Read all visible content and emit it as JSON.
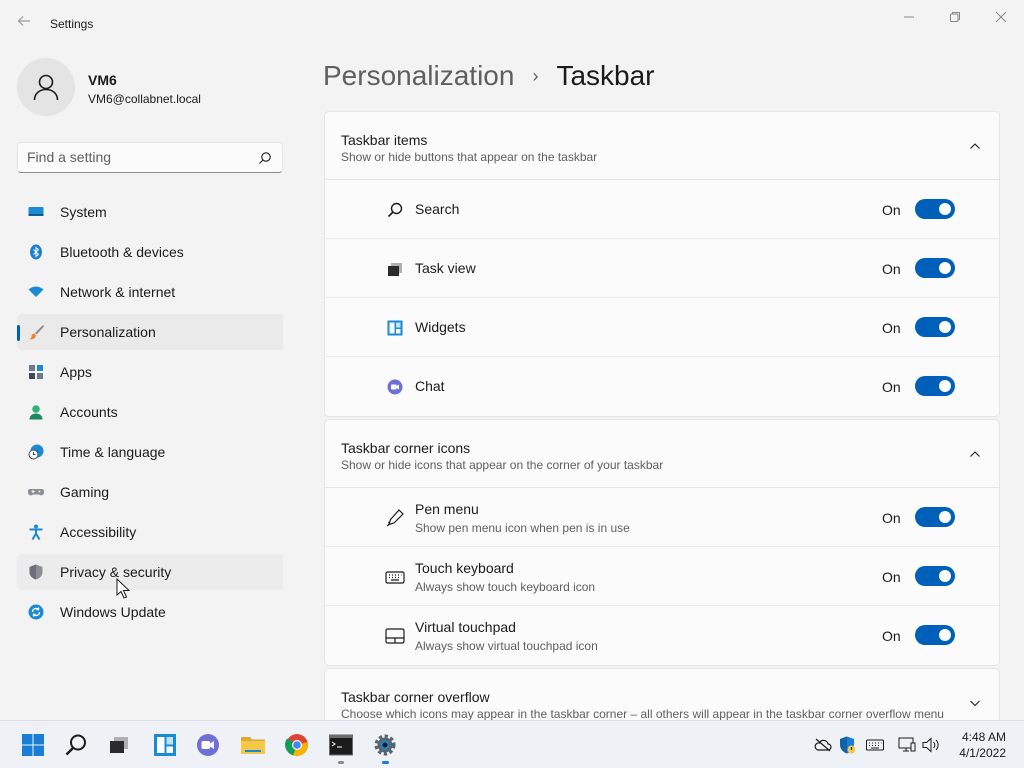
{
  "window": {
    "title": "Settings"
  },
  "profile": {
    "name": "VM6",
    "email": "VM6@collabnet.local"
  },
  "search": {
    "placeholder": "Find a setting"
  },
  "nav": {
    "items": [
      {
        "label": "System",
        "icon": "system-icon"
      },
      {
        "label": "Bluetooth & devices",
        "icon": "bluetooth-icon"
      },
      {
        "label": "Network & internet",
        "icon": "wifi-icon"
      },
      {
        "label": "Personalization",
        "icon": "brush-icon",
        "selected": true
      },
      {
        "label": "Apps",
        "icon": "apps-icon"
      },
      {
        "label": "Accounts",
        "icon": "accounts-icon"
      },
      {
        "label": "Time & language",
        "icon": "clock-globe-icon"
      },
      {
        "label": "Gaming",
        "icon": "gamepad-icon"
      },
      {
        "label": "Accessibility",
        "icon": "accessibility-icon"
      },
      {
        "label": "Privacy & security",
        "icon": "shield-icon",
        "hover": true
      },
      {
        "label": "Windows Update",
        "icon": "update-icon"
      }
    ]
  },
  "breadcrumb": {
    "parent": "Personalization",
    "separator": "›",
    "current": "Taskbar"
  },
  "sections": {
    "items": {
      "title": "Taskbar items",
      "description": "Show or hide buttons that appear on the taskbar",
      "rows": [
        {
          "label": "Search",
          "state": "On",
          "icon": "search-icon"
        },
        {
          "label": "Task view",
          "state": "On",
          "icon": "task-view-icon"
        },
        {
          "label": "Widgets",
          "state": "On",
          "icon": "widgets-icon"
        },
        {
          "label": "Chat",
          "state": "On",
          "icon": "chat-icon"
        }
      ]
    },
    "corner": {
      "title": "Taskbar corner icons",
      "description": "Show or hide icons that appear on the corner of your taskbar",
      "rows": [
        {
          "label": "Pen menu",
          "sub": "Show pen menu icon when pen is in use",
          "state": "On",
          "icon": "pen-icon"
        },
        {
          "label": "Touch keyboard",
          "sub": "Always show touch keyboard icon",
          "state": "On",
          "icon": "keyboard-icon"
        },
        {
          "label": "Virtual touchpad",
          "sub": "Always show virtual touchpad icon",
          "state": "On",
          "icon": "touchpad-icon"
        }
      ]
    },
    "overflow": {
      "title": "Taskbar corner overflow",
      "description": "Choose which icons may appear in the taskbar corner – all others will appear in the taskbar corner overflow menu"
    }
  },
  "taskbar": {
    "time": "4:48 AM",
    "date": "4/1/2022"
  },
  "colors": {
    "accent": "#005fb8",
    "background": "#f3f3f3",
    "card": "#fbfbfb"
  }
}
